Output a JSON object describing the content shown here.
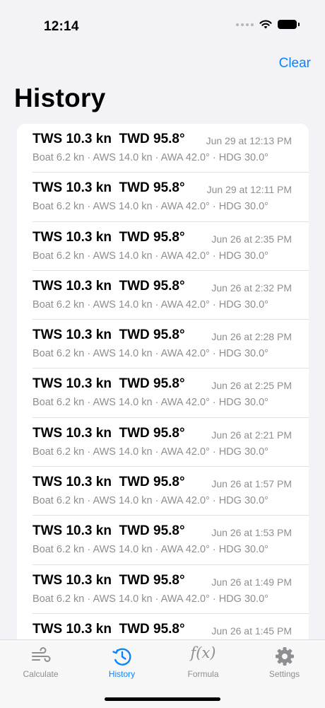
{
  "status_bar": {
    "time": "12:14"
  },
  "nav": {
    "clear_label": "Clear",
    "title": "History"
  },
  "history": [
    {
      "title": "TWS 10.3 kn  TWD 95.8°",
      "subtitle": "Boat 6.2 kn · AWS 14.0 kn · AWA 42.0° · HDG 30.0°",
      "date": "Jun 29 at 12:13 PM"
    },
    {
      "title": "TWS 10.3 kn  TWD 95.8°",
      "subtitle": "Boat 6.2 kn · AWS 14.0 kn · AWA 42.0° · HDG 30.0°",
      "date": "Jun 29 at 12:11 PM"
    },
    {
      "title": "TWS 10.3 kn  TWD 95.8°",
      "subtitle": "Boat 6.2 kn · AWS 14.0 kn · AWA 42.0° · HDG 30.0°",
      "date": "Jun 26 at 2:35 PM"
    },
    {
      "title": "TWS 10.3 kn  TWD 95.8°",
      "subtitle": "Boat 6.2 kn · AWS 14.0 kn · AWA 42.0° · HDG 30.0°",
      "date": "Jun 26 at 2:32 PM"
    },
    {
      "title": "TWS 10.3 kn  TWD 95.8°",
      "subtitle": "Boat 6.2 kn · AWS 14.0 kn · AWA 42.0° · HDG 30.0°",
      "date": "Jun 26 at 2:28 PM"
    },
    {
      "title": "TWS 10.3 kn  TWD 95.8°",
      "subtitle": "Boat 6.2 kn · AWS 14.0 kn · AWA 42.0° · HDG 30.0°",
      "date": "Jun 26 at 2:25 PM"
    },
    {
      "title": "TWS 10.3 kn  TWD 95.8°",
      "subtitle": "Boat 6.2 kn · AWS 14.0 kn · AWA 42.0° · HDG 30.0°",
      "date": "Jun 26 at 2:21 PM"
    },
    {
      "title": "TWS 10.3 kn  TWD 95.8°",
      "subtitle": "Boat 6.2 kn · AWS 14.0 kn · AWA 42.0° · HDG 30.0°",
      "date": "Jun 26 at 1:57 PM"
    },
    {
      "title": "TWS 10.3 kn  TWD 95.8°",
      "subtitle": "Boat 6.2 kn · AWS 14.0 kn · AWA 42.0° · HDG 30.0°",
      "date": "Jun 26 at 1:53 PM"
    },
    {
      "title": "TWS 10.3 kn  TWD 95.8°",
      "subtitle": "Boat 6.2 kn · AWS 14.0 kn · AWA 42.0° · HDG 30.0°",
      "date": "Jun 26 at 1:49 PM"
    },
    {
      "title": "TWS 10.3 kn  TWD 95.8°",
      "subtitle": "",
      "date": "Jun 26 at 1:45 PM"
    }
  ],
  "tab_bar": {
    "tabs": [
      {
        "label": "Calculate",
        "icon": "wind-icon"
      },
      {
        "label": "History",
        "icon": "clock-history-icon"
      },
      {
        "label": "Formula",
        "icon": "function-icon",
        "glyph": "f(x)"
      },
      {
        "label": "Settings",
        "icon": "gear-icon"
      }
    ],
    "active": "History"
  },
  "colors": {
    "accent": "#0a84ff",
    "secondary_text": "#8e8e93",
    "background": "#f2f2f7",
    "inactive_icon": "#8e8e93"
  }
}
